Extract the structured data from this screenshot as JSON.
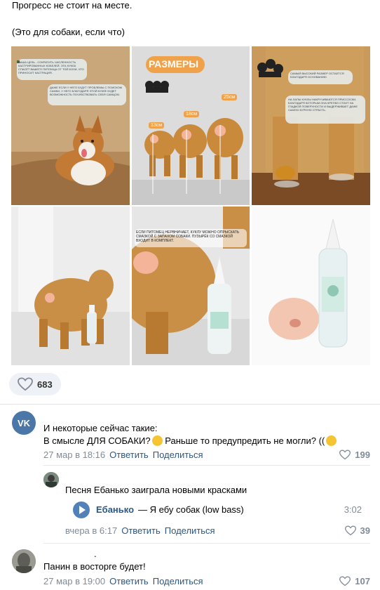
{
  "post": {
    "line1": "Прогресс не стоит на месте.",
    "line2": "(Это для собаки, если что)",
    "likes": "683"
  },
  "gallery": {
    "tile1": {
      "banner_text": "НАША ЦЕЛЬ - СОКРАТИТЬ ЧИСЛЕННОСТЬ КАСТРИРОВАННЫХ КОБЕЛЕЙ. ЭТА КУКЛА СПАСЁТ ВАШЕГО ПИТОМЦА ОТ ТОЙ БОЛИ, ЧТО ПРИНОСИТ КАСТРАЦИЯ.",
      "banner2": "ДАЖЕ ЕСЛИ У НЕГО БУДУТ ПРОБЛЕМЫ С ПОИСКОМ САМКИ, У НЕГО БЛАГОДАРЯ ЭТОЙ КУКЛЕ БУДЕТ ВОЗМОЖНОСТЬ ПОЧУВСТВОВАТЬ СЕБЯ САМЦОМ."
    },
    "tile2": {
      "heading": "РАЗМЕРЫ",
      "s1": "13см",
      "s2": "18см",
      "s3": "25см"
    },
    "tile3": {
      "banner1": "САМЫЙ ВЫСОКИЙ РАЗМЕР ОСТАЕТСЯ БЛАГОДАРЯ ОСНОВАНИЮ",
      "banner2": "НА ЛАПЫ КУКЛЫ НАКРУЧИВАЮТСЯ ПРИССОСКИ, БЛАГОДАРЯ КОТОРЫМ ОНА КРЕПКО СТОИТ НА ГЛАДКОЙ ПОВЕРХНОСТИ И ВЫДЕРЖИВАЕТ ДАЖЕ САМУЮ БУРНУЮ СТРАСТЬ."
    },
    "tile5": {
      "banner": "ЕСЛИ ПИТОМЕЦ НЕРВНИЧАЕТ, КУКЛУ МОЖНО ОПРЫСКАТЬ СМАЗКОЙ С ЗАПАХОМ СОБАКИ. ПУЗЫРЁК СО СМАЗКОЙ ВХОДИТ В КОМПЛЕКТ."
    }
  },
  "comments": [
    {
      "line1": "И некоторые сейчас такие:",
      "line2a": "В смысле ДЛЯ СОБАКИ?",
      "line2b": " Раньше то предупредить не могли? ((",
      "date": "27 мар в 18:16",
      "reply": "Ответить",
      "share": "Поделиться",
      "likes": "199"
    },
    {
      "text": "Песня Ебанько заиграла новыми красками",
      "audio": {
        "artist": "Ебанько",
        "title": "— Я ебу собак (low bass)",
        "duration": "3:02"
      },
      "date": "вчера в 6:17",
      "reply": "Ответить",
      "share": "Поделиться",
      "likes": "39"
    },
    {
      "name_dot": ".",
      "text": "Панин в восторге будет!",
      "date": "27 мар в 19:00",
      "reply": "Ответить",
      "share": "Поделиться",
      "likes": "107"
    }
  ],
  "colors": {
    "link": "#2a5885",
    "meta": "#818c99",
    "vk_blue": "#4a76a8"
  }
}
